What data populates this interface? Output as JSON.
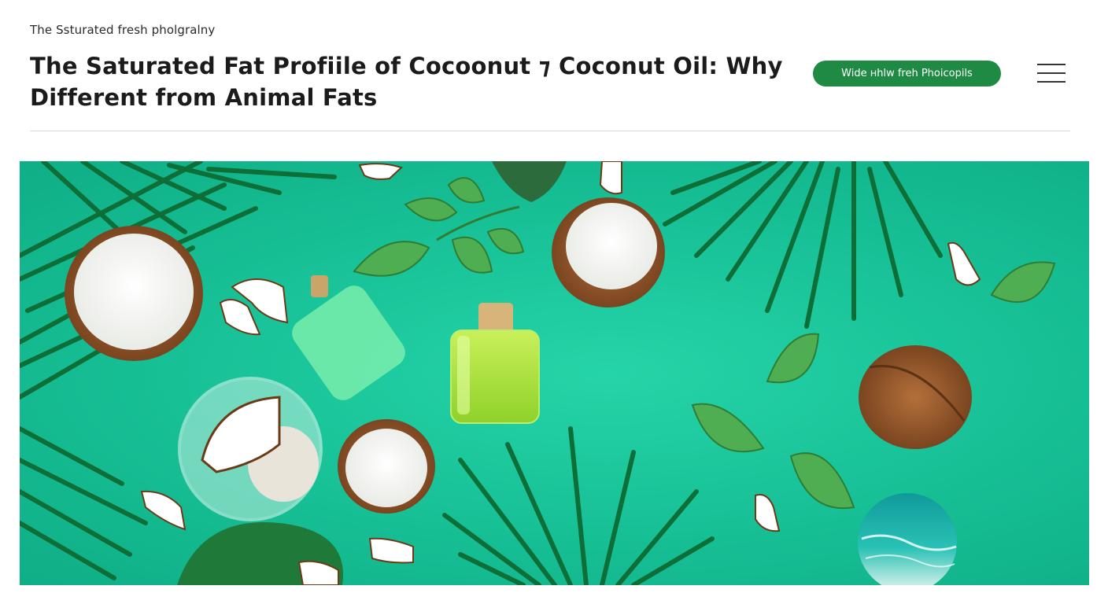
{
  "header": {
    "site_label": "The Ssturated fresh pholgralny",
    "title": "The Saturated Fat Profiile of  Cocoonut ⁊ Coconut Oil: Why Different from Animal Fats",
    "cta_label": "Wide нhlw freh Phoicopils",
    "menu_icon": "hamburger-menu-icon"
  },
  "hero": {
    "background_color": "#17bf95",
    "icon_names": [
      "palm-leaf",
      "coconut-half",
      "whole-coconut",
      "mint-leaf",
      "oil-bottle",
      "glass-bowl",
      "ocean-circle"
    ]
  },
  "colors": {
    "accent": "#1e8a43",
    "hero_teal": "#17bf95",
    "text": "#1b1b1b"
  }
}
